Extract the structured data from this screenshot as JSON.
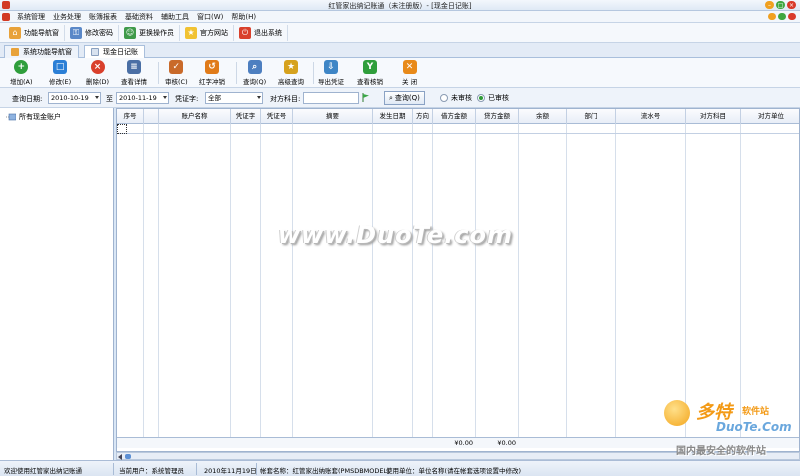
{
  "window": {
    "title": "红管家出纳记账通（未注册版）- [现金日记账]"
  },
  "menu": [
    {
      "label": "系统管理"
    },
    {
      "label": "业务处理"
    },
    {
      "label": "账簿报表"
    },
    {
      "label": "基础资料"
    },
    {
      "label": "辅助工具"
    },
    {
      "label": "窗口(W)"
    },
    {
      "label": "帮助(H)"
    }
  ],
  "top_toolbar": [
    {
      "label": "功能导航窗",
      "icon": "home-icon",
      "color": "#e8a23a"
    },
    {
      "label": "修改密码",
      "icon": "key-icon",
      "color": "#5a88c8"
    },
    {
      "label": "更换操作员",
      "icon": "users-icon",
      "color": "#3f9a4a"
    },
    {
      "label": "官方网站",
      "icon": "star-icon",
      "color": "#f1c232"
    },
    {
      "label": "退出系统",
      "icon": "power-icon",
      "color": "#d9402c"
    }
  ],
  "doc_tabs": [
    {
      "label": "系统功能导航窗"
    },
    {
      "label": "现金日记账"
    }
  ],
  "actions": [
    {
      "label": "增加(A)",
      "icon": "plus-icon",
      "color": "#2f9e3c",
      "glyph": "+"
    },
    {
      "label": "修改(E)",
      "icon": "edit-icon",
      "color": "#2b7fd6",
      "glyph": "□"
    },
    {
      "label": "删除(D)",
      "icon": "delete-icon",
      "color": "#d9402c",
      "glyph": "×"
    },
    {
      "label": "查看详情",
      "icon": "details-icon",
      "color": "#4a6fa5",
      "glyph": "≡"
    },
    {
      "label": "审核(C)",
      "icon": "audit-icon",
      "color": "#c96a2a",
      "glyph": "✓"
    },
    {
      "label": "红字冲销",
      "icon": "reverse-icon",
      "color": "#e07b1a",
      "glyph": "↺"
    },
    {
      "label": "查询(Q)",
      "icon": "search-icon",
      "color": "#4d7fc0",
      "glyph": "⌕"
    },
    {
      "label": "高级查询",
      "icon": "advanced-search-icon",
      "color": "#d6a21e",
      "glyph": "★"
    },
    {
      "label": "导出凭证",
      "icon": "export-icon",
      "color": "#3f86c6",
      "glyph": "⇩"
    },
    {
      "label": "查看核销",
      "icon": "excel-icon",
      "color": "#2f9e3c",
      "glyph": "Y"
    },
    {
      "label": "关 闭",
      "icon": "close-icon",
      "color": "#e88a1a",
      "glyph": "✕"
    }
  ],
  "filter": {
    "date_label": "查询日期:",
    "date_from": "2010-10-19",
    "to_label": "至",
    "date_to": "2010-11-19",
    "voucher_label": "凭证字:",
    "voucher_value": "全部",
    "account_label": "对方科目:",
    "account_value": "",
    "query_button": "查询(Q)",
    "radio_unaudited": "未审核",
    "radio_audited": "已审核"
  },
  "tree": {
    "root": "所有现金账户"
  },
  "grid": {
    "columns": [
      "序号",
      "",
      "账户名称",
      "凭证字",
      "凭证号",
      "摘要",
      "发生日期",
      "方向",
      "借方金额",
      "贷方金额",
      "余额",
      "部门",
      "流水号",
      "对方科目",
      "对方单位"
    ],
    "totals": {
      "debit": "¥0.00",
      "credit": "¥0.00"
    }
  },
  "status": {
    "welcome": "欢迎使用红管家出纳记账通",
    "user": "当前用户：系统管理员",
    "date": "2010年11月19日",
    "account_set": "帐套名称：红管家出纳账套(PMSDBMODEL)",
    "unit": "使用单位：单位名称(请在帐套选项设置中修改)"
  },
  "watermark": {
    "main": "www.DuoTe.com",
    "logo_cn": "多特",
    "logo_cn_small": "软件站",
    "logo_en": "DuoTe.Com",
    "slogan": "国内最安全的软件站"
  }
}
